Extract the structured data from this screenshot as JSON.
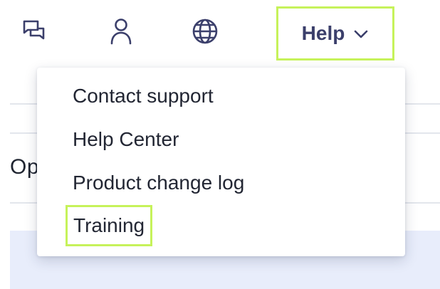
{
  "toolbar": {
    "icons": [
      {
        "name": "chat-icon"
      },
      {
        "name": "user-icon"
      },
      {
        "name": "globe-icon"
      }
    ],
    "help_label": "Help",
    "highlight_color": "#c6f25a",
    "text_color": "#3b3f6b"
  },
  "background": {
    "heading_partial": "Op"
  },
  "help_menu": {
    "items": [
      {
        "label": "Contact support"
      },
      {
        "label": "Help Center"
      },
      {
        "label": "Product change log"
      },
      {
        "label": "Training",
        "highlighted": true
      }
    ]
  }
}
